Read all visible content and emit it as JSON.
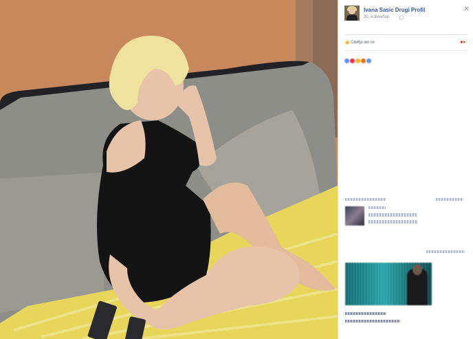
{
  "post": {
    "author": "Ivana Sasic Drugi Profil",
    "date": "30. новембар",
    "privacy_icon": "globe-icon",
    "close_icon": "close-icon"
  },
  "actions": {
    "like_label": "Свиђа ми се",
    "share_icon": "share-icon"
  },
  "reactions": {
    "colors": [
      "#5890ff",
      "#f0284a",
      "#f7b125",
      "#e9710f",
      "#5890ff"
    ]
  },
  "photo": {
    "subject": "blonde woman in black dress sitting on grey sofa",
    "colors": {
      "wall": "#c9875c",
      "sofa": "#8a8a84",
      "blanket": "#e8d65a",
      "dress": "#141414",
      "skin": "#e7c3a9"
    }
  },
  "colors": {
    "link": "#365899",
    "meta": "#90949c",
    "border": "#dddfe2"
  }
}
